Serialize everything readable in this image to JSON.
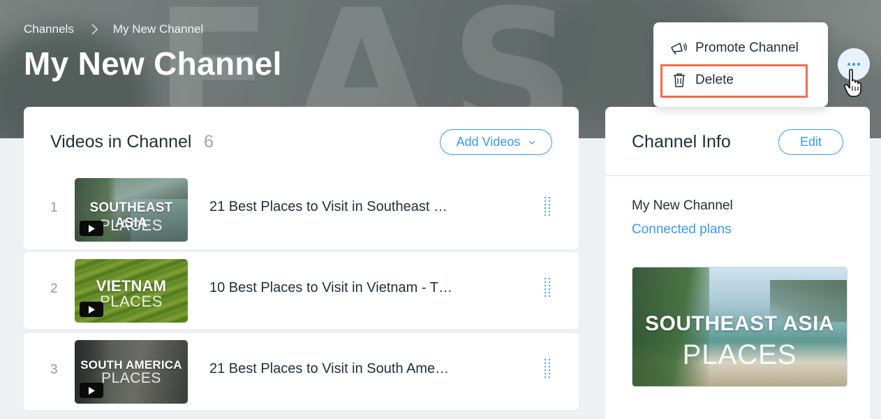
{
  "breadcrumb": {
    "root": "Channels",
    "current": "My New Channel"
  },
  "page": {
    "title": "My New Channel"
  },
  "videos_panel": {
    "title": "Videos in Channel",
    "count": "6",
    "add_button": "Add Videos"
  },
  "videos": [
    {
      "index": "1",
      "title": "21 Best Places to Visit in Southeast …",
      "thumb_line1": "SOUTHEAST ASIA",
      "thumb_line2": "PLACES"
    },
    {
      "index": "2",
      "title": "10 Best Places to Visit in Vietnam - T…",
      "thumb_line1": "VIETNAM",
      "thumb_line2": "PLACES"
    },
    {
      "index": "3",
      "title": "21 Best Places to Visit in South Ame…",
      "thumb_line1": "SOUTH AMERICA",
      "thumb_line2": "PLACES"
    }
  ],
  "info_panel": {
    "title": "Channel Info",
    "edit_button": "Edit",
    "channel_name": "My New Channel",
    "connected_plans_link": "Connected plans",
    "cover_line1": "SOUTHEAST ASIA",
    "cover_line2": "PLACES"
  },
  "more_menu": {
    "items": [
      {
        "label": "Promote Channel",
        "icon": "megaphone-icon"
      },
      {
        "label": "Delete",
        "icon": "trash-icon",
        "highlighted": true
      }
    ]
  },
  "colors": {
    "accent": "#3899ec",
    "highlight": "#f26b4f",
    "text": "#20303c",
    "muted": "#8c99a5"
  }
}
